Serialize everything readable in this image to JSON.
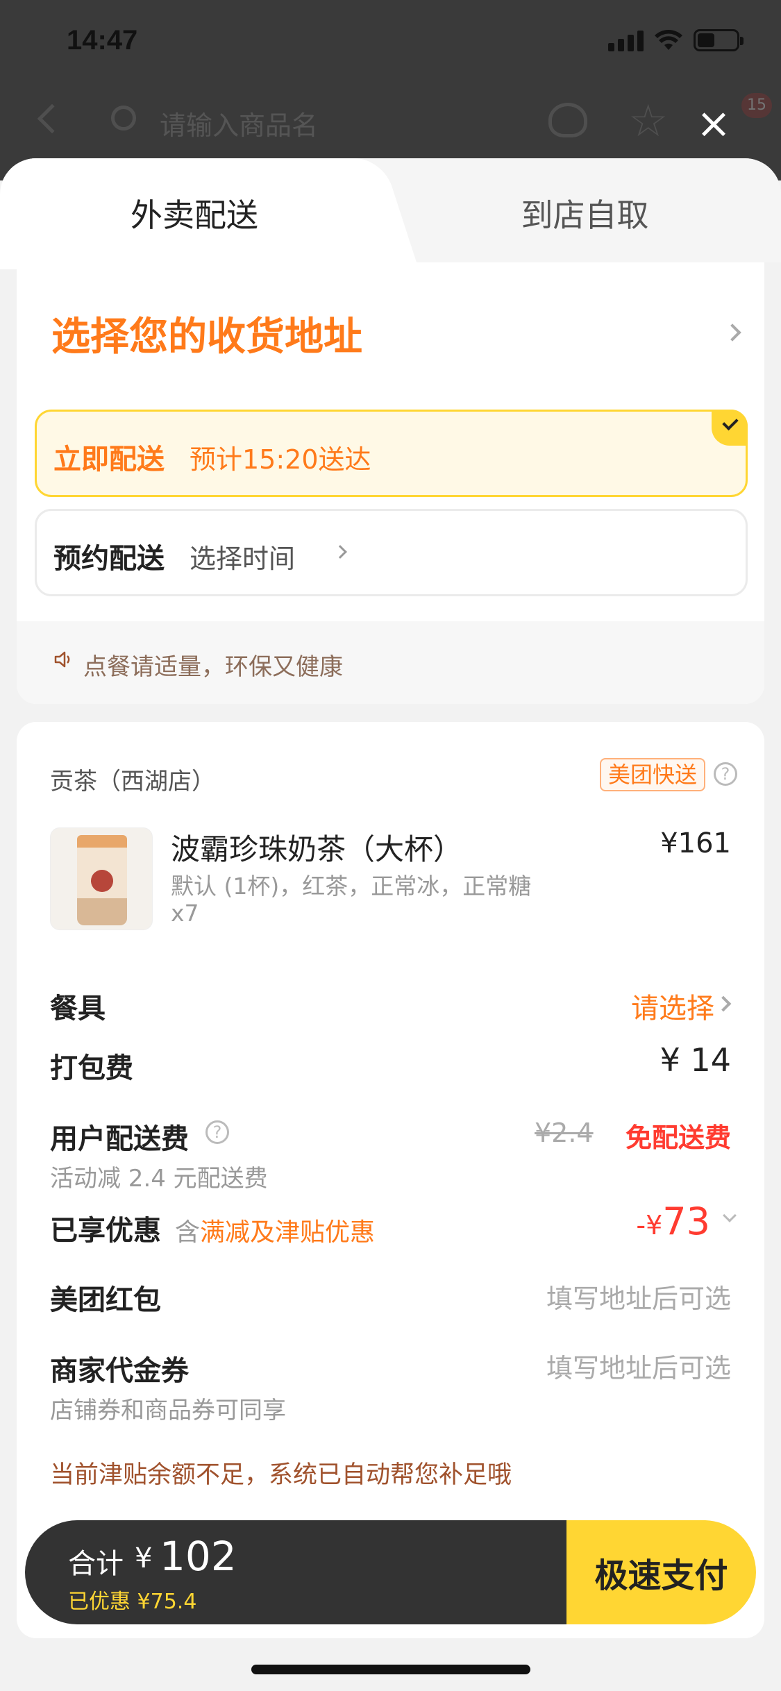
{
  "status_bar": {
    "time": "14:47"
  },
  "background_app": {
    "search_placeholder": "请输入商品名",
    "badge": "15"
  },
  "tabs": {
    "active": "外卖配送",
    "inactive": "到店自取"
  },
  "address": {
    "title": "选择您的收货地址"
  },
  "delivery_options": {
    "now": {
      "label": "立即配送",
      "detail": "预计15:20送达"
    },
    "scheduled": {
      "label": "预约配送",
      "detail": "选择时间"
    }
  },
  "eco_tip": "点餐请适量，环保又健康",
  "order": {
    "shop_name": "贡茶（西湖店）",
    "delivery_badge": "美团快送",
    "product": {
      "name": "波霸珍珠奶茶（大杯）",
      "price": "¥161",
      "spec": "默认 (1杯)，红茶，正常冰，正常糖",
      "qty": "x7"
    },
    "tableware": {
      "label": "餐具",
      "value": "请选择"
    },
    "packing": {
      "label": "打包费",
      "value": "¥ 14"
    },
    "delivery_fee": {
      "label": "用户配送费",
      "sub": "活动减 2.4 元配送费",
      "old": "¥2.4",
      "value": "免配送费"
    },
    "discount": {
      "label": "已享优惠",
      "sub_prefix": "含",
      "sub_highlight": "满减及津贴优惠",
      "currency": "-¥",
      "amount": "73"
    },
    "red_packet": {
      "label": "美团红包",
      "value": "填写地址后可选"
    },
    "voucher": {
      "label": "商家代金券",
      "value": "填写地址后可选",
      "sub": "店铺券和商品券可同享"
    },
    "notice": "当前津贴余额不足，系统已自动帮您补足哦"
  },
  "pay_bar": {
    "total_label": "合计",
    "currency": "¥",
    "total": "102",
    "saved": "已优惠 ¥75.4",
    "pay_button": "极速支付"
  },
  "colors": {
    "accent_orange": "#ff7a1a",
    "accent_yellow": "#ffd633",
    "price_red": "#ff3b30"
  }
}
